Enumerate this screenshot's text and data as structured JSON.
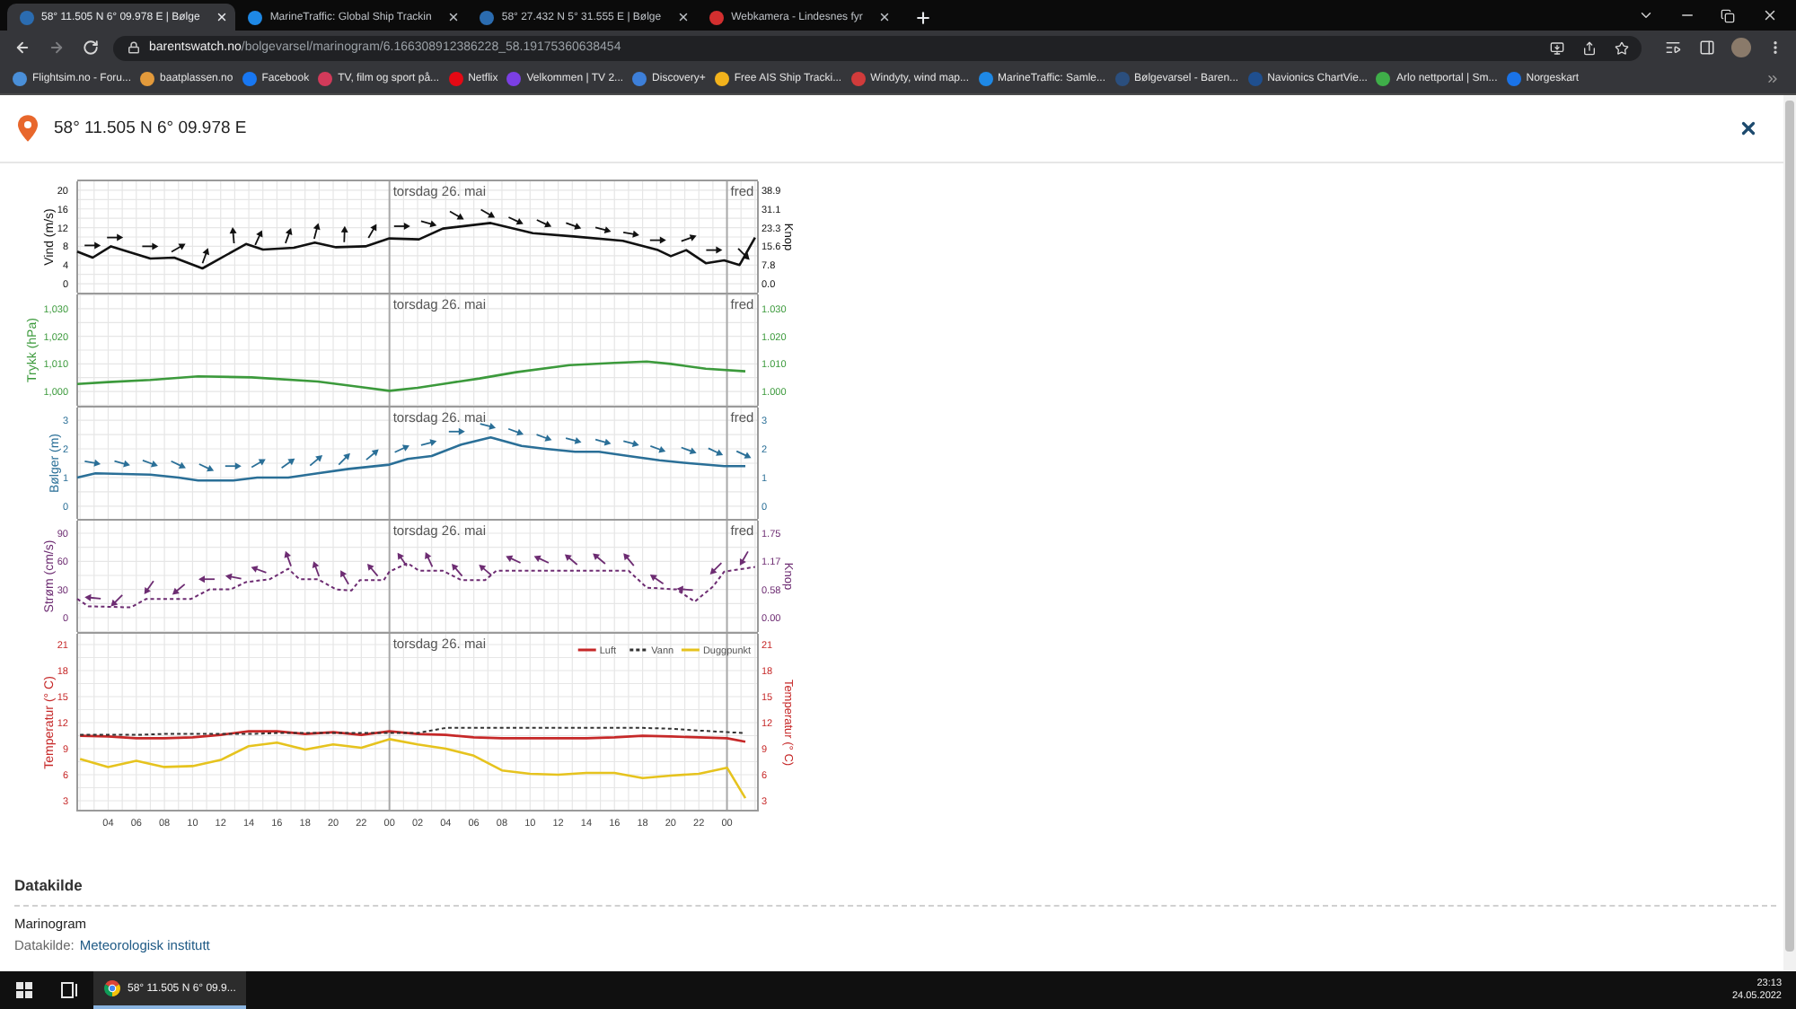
{
  "browser": {
    "tabs": [
      {
        "title": "58° 11.505 N 6° 09.978 E | Bølge",
        "selected": true,
        "color": "#2b6cb0"
      },
      {
        "title": "MarineTraffic: Global Ship Trackin",
        "selected": false,
        "color": "#1e88e5"
      },
      {
        "title": "58° 27.432 N 5° 31.555 E | Bølge",
        "selected": false,
        "color": "#2b6cb0"
      },
      {
        "title": "Webkamera - Lindesnes fyr",
        "selected": false,
        "color": "#d32f2f"
      }
    ],
    "address": {
      "domain": "barentswatch.no",
      "path": "/bolgevarsel/marinogram/6.166308912386228_58.19175360638454"
    },
    "bookmarks": [
      {
        "label": "Flightsim.no - Foru...",
        "color": "#4a8fd8"
      },
      {
        "label": "baatplassen.no",
        "color": "#e39a3b"
      },
      {
        "label": "Facebook",
        "color": "#1877f2"
      },
      {
        "label": "TV, film og sport på...",
        "color": "#d23a5a"
      },
      {
        "label": "Netflix",
        "color": "#e50914"
      },
      {
        "label": "Velkommen | TV 2...",
        "color": "#7b3fe4"
      },
      {
        "label": "Discovery+",
        "color": "#3d7fd9"
      },
      {
        "label": "Free AIS Ship Tracki...",
        "color": "#f2b21c"
      },
      {
        "label": "Windyty, wind map...",
        "color": "#d13b3b"
      },
      {
        "label": "MarineTraffic: Samle...",
        "color": "#1e88e5"
      },
      {
        "label": "Bølgevarsel - Baren...",
        "color": "#2b4f7e"
      },
      {
        "label": "Navionics ChartVie...",
        "color": "#1f4f8f"
      },
      {
        "label": "Arlo nettportal | Sm...",
        "color": "#3fae49"
      },
      {
        "label": "Norgeskart",
        "color": "#1a73e8"
      }
    ]
  },
  "page": {
    "title": "58° 11.505 N 6° 09.978 E",
    "panels": [
      {
        "day_labels": [
          "torsdag 26. mai",
          "fred"
        ],
        "chart_data": {
          "type": "line",
          "ylabel": "Vind (m/s)",
          "grid": true,
          "xlim": [
            1.8,
            50.2
          ],
          "ylim": [
            -1.9,
            21.9
          ],
          "yticks": [
            {
              "value": 20,
              "label": "20"
            },
            {
              "value": 16,
              "label": "16"
            },
            {
              "value": 12,
              "label": "12"
            },
            {
              "value": 8,
              "label": "8"
            },
            {
              "value": 4,
              "label": "4"
            },
            {
              "value": 0,
              "label": "0"
            }
          ],
          "x": [
            1.8,
            2.9,
            4.2,
            7.0,
            8.7,
            10.7,
            13.8,
            15.0,
            17.2,
            18.7,
            20.2,
            22.3,
            24,
            26.1,
            27.8,
            31.2,
            34.2,
            37.1,
            40.6,
            43.1,
            44.0,
            45.1,
            46.5,
            47.8,
            48.9,
            50.0
          ],
          "series": [
            {
              "color": "#111111",
              "line_style": "solid",
              "values": [
                6.9,
                5.6,
                8.0,
                5.4,
                5.6,
                3.3,
                8.5,
                7.3,
                7.7,
                8.8,
                7.8,
                8.0,
                9.7,
                9.5,
                11.8,
                13.0,
                10.8,
                10.1,
                9.2,
                7.2,
                5.9,
                7.2,
                4.4,
                5.0,
                4.0,
                9.9
              ]
            }
          ]
        },
        "right_axis": {
          "label": "Knop",
          "ticks": [
            "38.9",
            "31.1",
            "23.3",
            "15.6",
            "7.8",
            "0.0"
          ]
        }
      },
      {
        "day_labels": [
          "torsdag 26. mai",
          "fred"
        ],
        "chart_data": {
          "type": "line",
          "ylabel": "Trykk (hPa)",
          "grid": true,
          "xlim": [
            1.8,
            50.2
          ],
          "ylim": [
            994.8,
            1035.2
          ],
          "yticks": [
            {
              "value": 1030,
              "label": "1,030"
            },
            {
              "value": 1020,
              "label": "1,020"
            },
            {
              "value": 1010,
              "label": "1,010"
            },
            {
              "value": 1000,
              "label": "1,000"
            }
          ],
          "x": [
            1.8,
            4,
            7.0,
            10.4,
            14.2,
            18.9,
            22,
            24,
            26,
            28,
            30.4,
            33,
            36.8,
            40,
            42.3,
            44,
            46.5,
            49.3
          ],
          "series": [
            {
              "color": "#3c9a3c",
              "line_style": "solid",
              "values": [
                1002.7,
                1003.4,
                1004.2,
                1005.5,
                1005.1,
                1003.6,
                1001.6,
                1000.2,
                1001.3,
                1002.9,
                1004.7,
                1007.0,
                1009.5,
                1010.4,
                1010.8,
                1010.0,
                1008.2,
                1007.3
              ]
            }
          ]
        },
        "right_axis": {
          "ticks": [
            "1.030",
            "1.020",
            "1.010",
            "1.000"
          ]
        }
      },
      {
        "day_labels": [
          "torsdag 26. mai",
          "fred"
        ],
        "chart_data": {
          "type": "line",
          "ylabel": "Bølger (m)",
          "grid": true,
          "xlim": [
            1.8,
            50.2
          ],
          "ylim": [
            -0.44,
            3.44
          ],
          "yticks": [
            {
              "value": 3,
              "label": "3"
            },
            {
              "value": 2,
              "label": "2"
            },
            {
              "value": 1,
              "label": "1"
            },
            {
              "value": 0,
              "label": "0"
            }
          ],
          "x": [
            1.8,
            3.1,
            7.0,
            9.0,
            10.4,
            12.9,
            14.6,
            16.8,
            18.9,
            21.1,
            24,
            25.3,
            27.0,
            29.1,
            31.2,
            33.4,
            35.1,
            37.2,
            38.9,
            41.0,
            43.2,
            45.3,
            47.8,
            49.3
          ],
          "series": [
            {
              "color": "#2a6f97",
              "line_style": "solid",
              "values": [
                1.0,
                1.15,
                1.1,
                1.0,
                0.9,
                0.9,
                1.0,
                1.0,
                1.15,
                1.3,
                1.45,
                1.65,
                1.75,
                2.15,
                2.4,
                2.1,
                2.0,
                1.9,
                1.9,
                1.75,
                1.6,
                1.5,
                1.4,
                1.4
              ]
            }
          ]
        },
        "right_axis": {
          "ticks": [
            "3",
            "2",
            "1",
            "0"
          ]
        }
      },
      {
        "day_labels": [
          "torsdag 26. mai",
          "fred"
        ],
        "chart_data": {
          "type": "line",
          "ylabel": "Strøm (cm/s)",
          "grid": true,
          "xlim": [
            1.8,
            50.2
          ],
          "ylim": [
            -15.3,
            103.4
          ],
          "yticks": [
            {
              "value": 90,
              "label": "90"
            },
            {
              "value": 60,
              "label": "60"
            },
            {
              "value": 30,
              "label": "30"
            },
            {
              "value": 0,
              "label": "0"
            }
          ],
          "x": [
            1.8,
            2.6,
            5.6,
            6.7,
            9.9,
            11.2,
            12.7,
            13.8,
            15.5,
            16.8,
            17.6,
            18.9,
            20.2,
            21.3,
            21.9,
            23.6,
            24,
            25.3,
            26.1,
            27.8,
            29.1,
            30.8,
            31.6,
            41,
            42.3,
            44.4,
            45.7,
            47,
            47.8,
            50
          ],
          "series": [
            {
              "color": "#6d2c72",
              "line_style": "dashed",
              "values": [
                20,
                12,
                11,
                20,
                20,
                30,
                30,
                38,
                41,
                52,
                41,
                41,
                30,
                29,
                40,
                40,
                49,
                58,
                50,
                50,
                40,
                40,
                50,
                50,
                32,
                30,
                17,
                33,
                49,
                54
              ]
            }
          ]
        },
        "right_axis": {
          "label": "Knop",
          "ticks": [
            "1.75",
            "1.17",
            "0.58",
            "0.00"
          ]
        }
      },
      {
        "day_labels": [
          "torsdag 26. mai"
        ],
        "chart_data": {
          "type": "line",
          "ylabel": "Temperatur (° C)",
          "grid": true,
          "legend": "upper right",
          "xlim": [
            1.8,
            50.2
          ],
          "ylim": [
            1.76,
            22.24
          ],
          "yticks": [
            {
              "value": 21,
              "label": "21"
            },
            {
              "value": 18,
              "label": "18"
            },
            {
              "value": 15,
              "label": "15"
            },
            {
              "value": 12,
              "label": "12"
            },
            {
              "value": 9,
              "label": "9"
            },
            {
              "value": 6,
              "label": "6"
            },
            {
              "value": 3,
              "label": "3"
            }
          ],
          "xticks": [
            {
              "value": 4,
              "label": "04"
            },
            {
              "value": 6,
              "label": "06"
            },
            {
              "value": 8,
              "label": "08"
            },
            {
              "value": 10,
              "label": "10"
            },
            {
              "value": 12,
              "label": "12"
            },
            {
              "value": 14,
              "label": "14"
            },
            {
              "value": 16,
              "label": "16"
            },
            {
              "value": 18,
              "label": "18"
            },
            {
              "value": 20,
              "label": "20"
            },
            {
              "value": 22,
              "label": "22"
            },
            {
              "value": 24,
              "label": "00"
            },
            {
              "value": 26,
              "label": "02"
            },
            {
              "value": 28,
              "label": "04"
            },
            {
              "value": 30,
              "label": "06"
            },
            {
              "value": 32,
              "label": "08"
            },
            {
              "value": 34,
              "label": "10"
            },
            {
              "value": 36,
              "label": "12"
            },
            {
              "value": 38,
              "label": "14"
            },
            {
              "value": 40,
              "label": "16"
            },
            {
              "value": 42,
              "label": "18"
            },
            {
              "value": 44,
              "label": "20"
            },
            {
              "value": 46,
              "label": "22"
            },
            {
              "value": 48,
              "label": "00"
            }
          ],
          "x": [
            2,
            4,
            6,
            8,
            10,
            12,
            14,
            16,
            18,
            20,
            22,
            24,
            26,
            28,
            30,
            32,
            34,
            36,
            38,
            40,
            42,
            44,
            46,
            48,
            49.3
          ],
          "series": [
            {
              "name": "Luft",
              "color": "#c62828",
              "line_style": "solid",
              "values": [
                10.5,
                10.4,
                10.2,
                10.2,
                10.3,
                10.6,
                11.0,
                11.0,
                10.7,
                10.9,
                10.6,
                11.0,
                10.7,
                10.6,
                10.3,
                10.2,
                10.2,
                10.2,
                10.2,
                10.3,
                10.5,
                10.4,
                10.3,
                10.2,
                9.8
              ]
            },
            {
              "name": "Vann",
              "color": "#333333",
              "line_style": "dashed",
              "values": [
                10.6,
                10.6,
                10.6,
                10.7,
                10.7,
                10.7,
                10.7,
                10.8,
                10.8,
                10.8,
                10.8,
                10.8,
                10.8,
                11.4,
                11.4,
                11.4,
                11.4,
                11.4,
                11.4,
                11.4,
                11.4,
                11.3,
                11.1,
                10.9,
                10.8
              ]
            },
            {
              "name": "Duggpunkt",
              "color": "#e6c31e",
              "line_style": "solid",
              "values": [
                7.8,
                6.9,
                7.6,
                6.9,
                7.0,
                7.7,
                9.3,
                9.7,
                8.9,
                9.5,
                9.1,
                10.1,
                9.5,
                9.0,
                8.2,
                6.5,
                6.1,
                6.0,
                6.2,
                6.2,
                5.6,
                5.9,
                6.1,
                6.8,
                3.3
              ]
            }
          ]
        },
        "right_axis": {
          "label": "Temperatur (° C)",
          "ticks": [
            "21",
            "18",
            "15",
            "12",
            "9",
            "6",
            "3"
          ]
        }
      }
    ],
    "source": {
      "heading": "Datakilde",
      "title": "Marinogram",
      "label": "Datakilde:",
      "link": "Meteorologisk institutt"
    }
  },
  "taskbar": {
    "apps": [
      {
        "label": "58° 11.505 N 6° 09.9...",
        "selected": true
      }
    ],
    "time": "23:13",
    "date": "24.05.2022"
  }
}
